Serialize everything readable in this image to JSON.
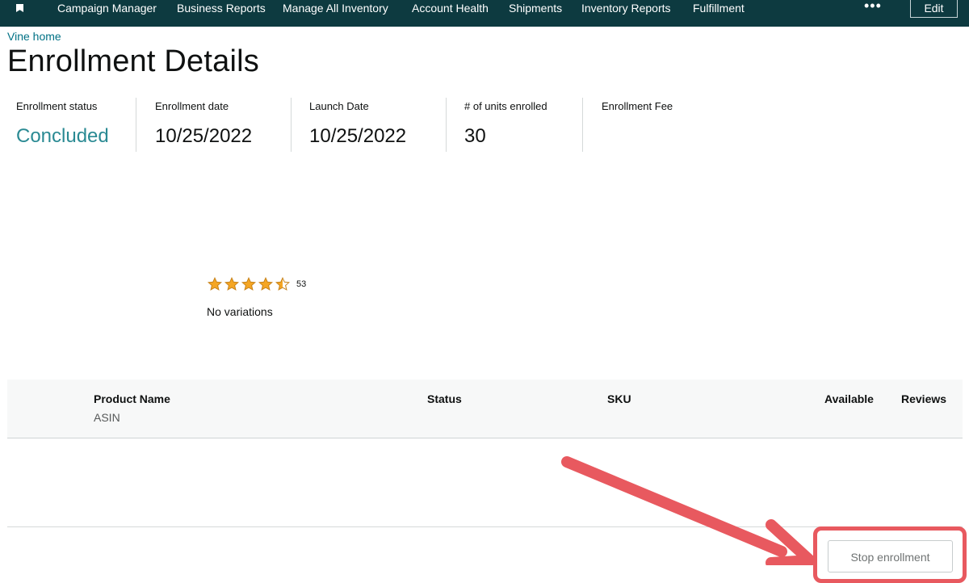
{
  "nav": {
    "items": [
      "Campaign Manager",
      "Business Reports",
      "Manage All Inventory",
      "Account Health",
      "Shipments",
      "Inventory Reports",
      "Fulfillment"
    ],
    "more_label": "•••",
    "edit_label": "Edit"
  },
  "breadcrumb": "Vine home",
  "page_title": "Enrollment Details",
  "stats": [
    {
      "label": "Enrollment status",
      "value": "Concluded"
    },
    {
      "label": "Enrollment date",
      "value": "10/25/2022"
    },
    {
      "label": "Launch Date",
      "value": "10/25/2022"
    },
    {
      "label": "# of units enrolled",
      "value": "30"
    },
    {
      "label": "Enrollment Fee",
      "value": ""
    }
  ],
  "product": {
    "rating": 4.5,
    "rating_max": 5,
    "rating_count": "53",
    "variations": "No variations"
  },
  "table": {
    "headers": [
      "Product Name",
      "Status",
      "SKU",
      "Available",
      "Reviews"
    ],
    "product_sub": "ASIN"
  },
  "actions": {
    "stop_label": "Stop enrollment"
  },
  "colors": {
    "nav_bg": "#0d3a40",
    "link": "#007185",
    "status_teal": "#2a8a93",
    "star": "#f5a623",
    "annotation": "#e8595f"
  }
}
